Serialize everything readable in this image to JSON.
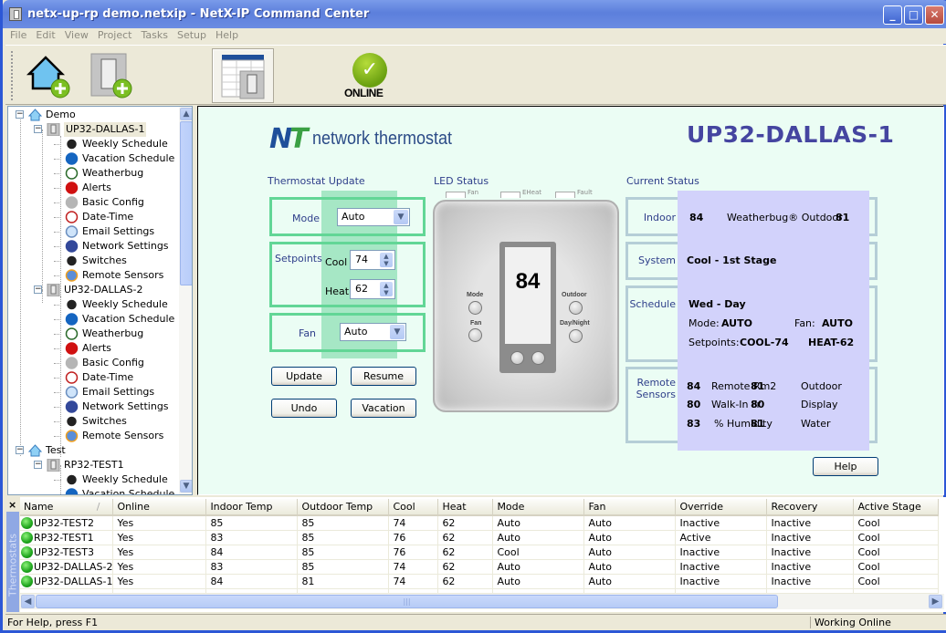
{
  "window": {
    "title": "netx-up-rp demo.netxip - NetX-IP Command Center",
    "controls": {
      "minimize": "_",
      "maximize": "□",
      "close": "✕"
    }
  },
  "menu": [
    "File",
    "Edit",
    "View",
    "Project",
    "Tasks",
    "Setup",
    "Help"
  ],
  "toolbar": {
    "buttons": [
      {
        "name": "add-site",
        "icon": "house-plus-icon"
      },
      {
        "name": "add-thermostat",
        "icon": "thermostat-plus-icon"
      },
      {
        "name": "thermostat-view",
        "icon": "thermostat-grid-icon",
        "selected": true
      }
    ],
    "status_label": "ONLINE",
    "status_icon": "checkmark-icon"
  },
  "tree": {
    "sites": [
      {
        "name": "Demo",
        "devices": [
          {
            "name": "UP32-DALLAS-1",
            "selected": true,
            "items": [
              "Weekly Schedule",
              "Vacation Schedule",
              "Weatherbug",
              "Alerts",
              "Basic Config",
              "Date-Time",
              "Email Settings",
              "Network Settings",
              "Switches",
              "Remote Sensors"
            ]
          },
          {
            "name": "UP32-DALLAS-2",
            "items": [
              "Weekly Schedule",
              "Vacation Schedule",
              "Weatherbug",
              "Alerts",
              "Basic Config",
              "Date-Time",
              "Email Settings",
              "Network Settings",
              "Switches",
              "Remote Sensors"
            ]
          }
        ]
      },
      {
        "name": "Test",
        "devices": [
          {
            "name": "RP32-TEST1",
            "items": [
              "Weekly Schedule",
              "Vacation Schedule"
            ]
          }
        ]
      }
    ],
    "expand_symbol": "−"
  },
  "panel": {
    "logo_mark_n": "N",
    "logo_mark_t": "T",
    "logo_text": "network thermostat",
    "device_title": "UP32-DALLAS-1",
    "update": {
      "heading": "Thermostat Update",
      "mode_label": "Mode",
      "mode_value": "Auto",
      "setpoints_label": "Setpoints",
      "cool_label": "Cool",
      "cool_value": "74",
      "heat_label": "Heat",
      "heat_value": "62",
      "fan_label": "Fan",
      "fan_value": "Auto",
      "buttons": {
        "update": "Update",
        "resume": "Resume",
        "undo": "Undo",
        "vacation": "Vacation"
      }
    },
    "led": {
      "heading": "LED Status",
      "leds": [
        "Fan",
        "EHeat",
        "Fault"
      ],
      "display_value": "84",
      "left_buttons": [
        "Mode",
        "Fan"
      ],
      "right_buttons": [
        "Outdoor",
        "Day/Night"
      ]
    },
    "status": {
      "heading": "Current Status",
      "indoor_label": "Indoor",
      "indoor_value": "84",
      "outdoor_label": "Weatherbug® Outdoor",
      "outdoor_value": "81",
      "system_label": "System",
      "system_value": "Cool - 1st Stage",
      "schedule_label": "Schedule",
      "schedule_period": "Wed - Day",
      "schedule_mode_label": "Mode:",
      "schedule_mode": "AUTO",
      "schedule_fan_label": "Fan:",
      "schedule_fan": "AUTO",
      "schedule_setpoints_label": "Setpoints:",
      "schedule_cool": "COOL-74",
      "schedule_heat": "HEAT-62",
      "sensors_label_1": "Remote",
      "sensors_label_2": "Sensors",
      "sensors": [
        {
          "value": "84",
          "name": "Remote Rm2"
        },
        {
          "value": "81",
          "name": "Outdoor"
        },
        {
          "value": "80",
          "name": "Walk-In Fr"
        },
        {
          "value": "80",
          "name": "Display"
        },
        {
          "value": "83",
          "name": "% Humidity"
        },
        {
          "value": "81",
          "name": "Water"
        }
      ],
      "help_button": "Help"
    }
  },
  "grid": {
    "side_tab": "Thermostats",
    "close": "×",
    "sort_indicator": "/",
    "columns": [
      "Name",
      "Online",
      "Indoor Temp",
      "Outdoor Temp",
      "Cool",
      "Heat",
      "Mode",
      "Fan",
      "Override",
      "Recovery",
      "Active Stage"
    ],
    "rows": [
      [
        "UP32-TEST2",
        "Yes",
        "85",
        "85",
        "74",
        "62",
        "Auto",
        "Auto",
        "Inactive",
        "Inactive",
        "Cool"
      ],
      [
        "RP32-TEST1",
        "Yes",
        "83",
        "85",
        "76",
        "62",
        "Auto",
        "Auto",
        "Active",
        "Inactive",
        "Cool"
      ],
      [
        "UP32-TEST3",
        "Yes",
        "84",
        "85",
        "76",
        "62",
        "Cool",
        "Auto",
        "Inactive",
        "Inactive",
        "Cool"
      ],
      [
        "UP32-DALLAS-2",
        "Yes",
        "83",
        "85",
        "74",
        "62",
        "Auto",
        "Auto",
        "Inactive",
        "Inactive",
        "Cool"
      ],
      [
        "UP32-DALLAS-1",
        "Yes",
        "84",
        "81",
        "74",
        "62",
        "Auto",
        "Auto",
        "Inactive",
        "Inactive",
        "Cool"
      ]
    ],
    "status_color": "#1fa51d"
  },
  "statusbar": {
    "left": "For Help, press F1",
    "right": "Working Online"
  }
}
